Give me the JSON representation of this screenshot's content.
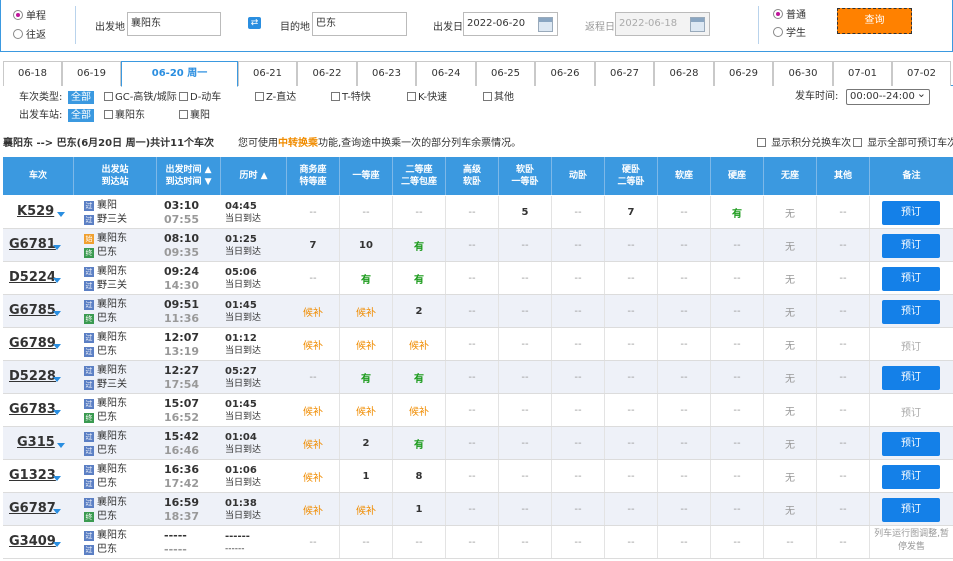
{
  "search": {
    "one_way": "单程",
    "round_trip": "往返",
    "from_label": "出发地",
    "from_value": "襄阳东",
    "to_label": "目的地",
    "to_value": "巴东",
    "depart_label": "出发日",
    "depart_value": "2022-06-20",
    "return_label": "返程日",
    "return_value": "2022-06-18",
    "normal": "普通",
    "student": "学生",
    "query": "查询"
  },
  "dates": [
    "06-18",
    "06-19",
    "06-20 周一",
    "06-21",
    "06-22",
    "06-23",
    "06-24",
    "06-25",
    "06-26",
    "06-27",
    "06-28",
    "06-29",
    "06-30",
    "07-01",
    "07-02"
  ],
  "filters": {
    "type_label": "车次类型:",
    "all": "全部",
    "types": [
      "GC-高铁/城际",
      "D-动车",
      "Z-直达",
      "T-特快",
      "K-快速",
      "其他"
    ],
    "station_label": "出发车站:",
    "stations": [
      "襄阳东",
      "襄阳"
    ],
    "time_label": "发车时间:",
    "time_value": "00:00--24:00"
  },
  "info": {
    "route": "襄阳东 --> 巴东(6月20日 周一)共计11个车次",
    "hint_pre": "您可使用",
    "hint_link": "中转换乘",
    "hint_post": "功能,查询途中换乘一次的部分列车余票情况。",
    "opt1": "显示积分兑换车次",
    "opt2": "显示全部可预订车次"
  },
  "headers": {
    "train": "车次",
    "stations_a": "出发站",
    "stations_b": "到达站",
    "time_a": "出发时间 ▲",
    "time_b": "到达时间 ▼",
    "dur": "历时 ▲",
    "biz_a": "商务座",
    "biz_b": "特等座",
    "first": "一等座",
    "second_a": "二等座",
    "second_b": "二等包座",
    "adv_a": "高级",
    "adv_b": "软卧",
    "sl_a": "软卧",
    "sl_b": "一等卧",
    "dw": "动卧",
    "hs_a": "硬卧",
    "hs_b": "二等卧",
    "ss": "软座",
    "hseat": "硬座",
    "noseat": "无座",
    "other": "其他",
    "remark": "备注"
  },
  "rows": [
    {
      "no": "K529",
      "from": "襄阳",
      "from_tag": "过",
      "to": "野三关",
      "to_tag": "过",
      "dep": "03:10",
      "arr": "07:55",
      "dur": "04:45",
      "day": "当日到达",
      "seats": [
        "--",
        "--",
        "--",
        "--",
        "5",
        "--",
        "7",
        "--",
        "有",
        "无",
        "--"
      ],
      "action": "预订",
      "enabled": true
    },
    {
      "no": "G6781",
      "from": "襄阳东",
      "from_tag": "始",
      "to": "巴东",
      "to_tag": "终",
      "dep": "08:10",
      "arr": "09:35",
      "dur": "01:25",
      "day": "当日到达",
      "seats": [
        "7",
        "10",
        "有",
        "--",
        "--",
        "--",
        "--",
        "--",
        "--",
        "无",
        "--"
      ],
      "action": "预订",
      "enabled": true
    },
    {
      "no": "D5224",
      "from": "襄阳东",
      "from_tag": "过",
      "to": "野三关",
      "to_tag": "过",
      "dep": "09:24",
      "arr": "14:30",
      "dur": "05:06",
      "day": "当日到达",
      "seats": [
        "--",
        "有",
        "有",
        "--",
        "--",
        "--",
        "--",
        "--",
        "--",
        "无",
        "--"
      ],
      "action": "预订",
      "enabled": true
    },
    {
      "no": "G6785",
      "from": "襄阳东",
      "from_tag": "过",
      "to": "巴东",
      "to_tag": "终",
      "dep": "09:51",
      "arr": "11:36",
      "dur": "01:45",
      "day": "当日到达",
      "seats": [
        "候补",
        "候补",
        "2",
        "--",
        "--",
        "--",
        "--",
        "--",
        "--",
        "无",
        "--"
      ],
      "action": "预订",
      "enabled": true
    },
    {
      "no": "G6789",
      "from": "襄阳东",
      "from_tag": "过",
      "to": "巴东",
      "to_tag": "过",
      "dep": "12:07",
      "arr": "13:19",
      "dur": "01:12",
      "day": "当日到达",
      "seats": [
        "候补",
        "候补",
        "候补",
        "--",
        "--",
        "--",
        "--",
        "--",
        "--",
        "无",
        "--"
      ],
      "action": "预订",
      "enabled": false
    },
    {
      "no": "D5228",
      "from": "襄阳东",
      "from_tag": "过",
      "to": "野三关",
      "to_tag": "过",
      "dep": "12:27",
      "arr": "17:54",
      "dur": "05:27",
      "day": "当日到达",
      "seats": [
        "--",
        "有",
        "有",
        "--",
        "--",
        "--",
        "--",
        "--",
        "--",
        "无",
        "--"
      ],
      "action": "预订",
      "enabled": true
    },
    {
      "no": "G6783",
      "from": "襄阳东",
      "from_tag": "过",
      "to": "巴东",
      "to_tag": "终",
      "dep": "15:07",
      "arr": "16:52",
      "dur": "01:45",
      "day": "当日到达",
      "seats": [
        "候补",
        "候补",
        "候补",
        "--",
        "--",
        "--",
        "--",
        "--",
        "--",
        "无",
        "--"
      ],
      "action": "预订",
      "enabled": false
    },
    {
      "no": "G315",
      "from": "襄阳东",
      "from_tag": "过",
      "to": "巴东",
      "to_tag": "过",
      "dep": "15:42",
      "arr": "16:46",
      "dur": "01:04",
      "day": "当日到达",
      "seats": [
        "候补",
        "2",
        "有",
        "--",
        "--",
        "--",
        "--",
        "--",
        "--",
        "无",
        "--"
      ],
      "action": "预订",
      "enabled": true
    },
    {
      "no": "G1323",
      "from": "襄阳东",
      "from_tag": "过",
      "to": "巴东",
      "to_tag": "过",
      "dep": "16:36",
      "arr": "17:42",
      "dur": "01:06",
      "day": "当日到达",
      "seats": [
        "候补",
        "1",
        "8",
        "--",
        "--",
        "--",
        "--",
        "--",
        "--",
        "无",
        "--"
      ],
      "action": "预订",
      "enabled": true
    },
    {
      "no": "G6787",
      "from": "襄阳东",
      "from_tag": "过",
      "to": "巴东",
      "to_tag": "终",
      "dep": "16:59",
      "arr": "18:37",
      "dur": "01:38",
      "day": "当日到达",
      "seats": [
        "候补",
        "候补",
        "1",
        "--",
        "--",
        "--",
        "--",
        "--",
        "--",
        "无",
        "--"
      ],
      "action": "预订",
      "enabled": true
    },
    {
      "no": "G3409",
      "from": "襄阳东",
      "from_tag": "过",
      "to": "巴东",
      "to_tag": "过",
      "dep": "-----",
      "arr": "-----",
      "dur": "------",
      "day": "------",
      "seats": [
        "--",
        "--",
        "--",
        "--",
        "--",
        "--",
        "--",
        "--",
        "--",
        "--",
        "--"
      ],
      "note": "列车运行图调整,暂停发售",
      "enabled": false
    }
  ]
}
